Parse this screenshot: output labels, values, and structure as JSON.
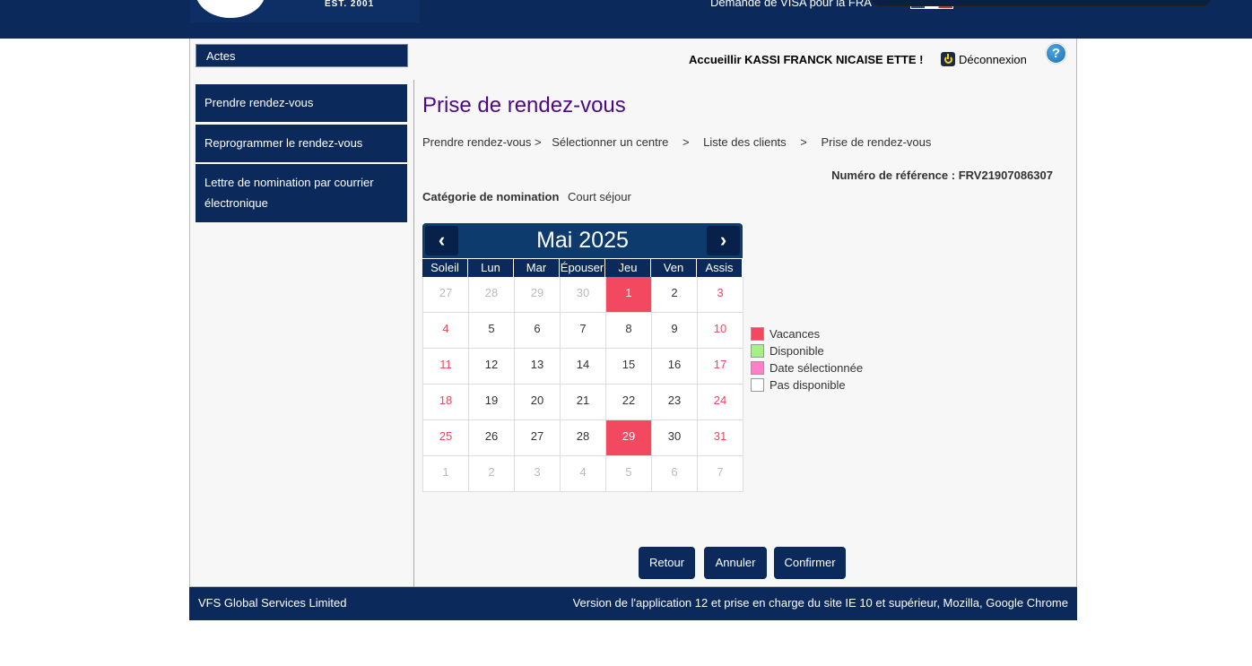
{
  "header": {
    "logo_text": "EST. 2001",
    "title": "Demande de VISA pour la FRA"
  },
  "sidebar": {
    "heading": "Actes",
    "items": [
      {
        "label": "Prendre rendez-vous"
      },
      {
        "label": "Reprogrammer le rendez-vous"
      },
      {
        "label": "Lettre de nomination par courrier électronique"
      }
    ]
  },
  "user": {
    "welcome": "Accueillir KASSI FRANCK NICAISE ETTE !",
    "logout": "Déconnexion",
    "help": "?"
  },
  "page": {
    "title": "Prise de rendez-vous",
    "breadcrumb": [
      "Prendre rendez-vous >",
      "Sélectionner un centre",
      ">",
      "Liste des clients",
      ">",
      "Prise de rendez-vous"
    ],
    "reference": "Numéro de référence : FRV21907086307",
    "category_label": "Catégorie de nomination",
    "category_value": "Court séjour"
  },
  "calendar": {
    "month_label": "Mai 2025",
    "prev": "‹",
    "next": "›",
    "weekdays": [
      "Soleil",
      "Lun",
      "Mar",
      "Épouser",
      "Jeu",
      "Ven",
      "Assis"
    ],
    "weeks": [
      [
        {
          "d": "27",
          "s": "other"
        },
        {
          "d": "28",
          "s": "other"
        },
        {
          "d": "29",
          "s": "other"
        },
        {
          "d": "30",
          "s": "other"
        },
        {
          "d": "1",
          "s": "holiday"
        },
        {
          "d": "2",
          "s": "normal"
        },
        {
          "d": "3",
          "s": "weekend"
        }
      ],
      [
        {
          "d": "4",
          "s": "weekend"
        },
        {
          "d": "5",
          "s": "normal"
        },
        {
          "d": "6",
          "s": "normal"
        },
        {
          "d": "7",
          "s": "normal"
        },
        {
          "d": "8",
          "s": "normal"
        },
        {
          "d": "9",
          "s": "normal"
        },
        {
          "d": "10",
          "s": "weekend"
        }
      ],
      [
        {
          "d": "11",
          "s": "weekend"
        },
        {
          "d": "12",
          "s": "normal"
        },
        {
          "d": "13",
          "s": "normal"
        },
        {
          "d": "14",
          "s": "normal"
        },
        {
          "d": "15",
          "s": "normal"
        },
        {
          "d": "16",
          "s": "normal"
        },
        {
          "d": "17",
          "s": "weekend"
        }
      ],
      [
        {
          "d": "18",
          "s": "weekend"
        },
        {
          "d": "19",
          "s": "normal"
        },
        {
          "d": "20",
          "s": "normal"
        },
        {
          "d": "21",
          "s": "normal"
        },
        {
          "d": "22",
          "s": "normal"
        },
        {
          "d": "23",
          "s": "normal"
        },
        {
          "d": "24",
          "s": "weekend"
        }
      ],
      [
        {
          "d": "25",
          "s": "weekend"
        },
        {
          "d": "26",
          "s": "normal"
        },
        {
          "d": "27",
          "s": "normal"
        },
        {
          "d": "28",
          "s": "normal"
        },
        {
          "d": "29",
          "s": "holiday"
        },
        {
          "d": "30",
          "s": "normal"
        },
        {
          "d": "31",
          "s": "weekend"
        }
      ],
      [
        {
          "d": "1",
          "s": "other"
        },
        {
          "d": "2",
          "s": "other"
        },
        {
          "d": "3",
          "s": "other"
        },
        {
          "d": "4",
          "s": "other"
        },
        {
          "d": "5",
          "s": "other"
        },
        {
          "d": "6",
          "s": "other"
        },
        {
          "d": "7",
          "s": "other"
        }
      ]
    ]
  },
  "legend": [
    {
      "label": "Vacances",
      "color": "#f24860"
    },
    {
      "label": "Disponible",
      "color": "#a6f08a"
    },
    {
      "label": "Date sélectionnée",
      "color": "#ff80c8"
    },
    {
      "label": "Pas disponible",
      "color": "#ffffff"
    }
  ],
  "buttons": {
    "back": "Retour",
    "cancel": "Annuler",
    "confirm": "Confirmer"
  },
  "footer": {
    "left": "VFS Global Services Limited",
    "right": "Version de l'application 12 et prise en charge du site IE 10 et supérieur, Mozilla, Google Chrome"
  }
}
